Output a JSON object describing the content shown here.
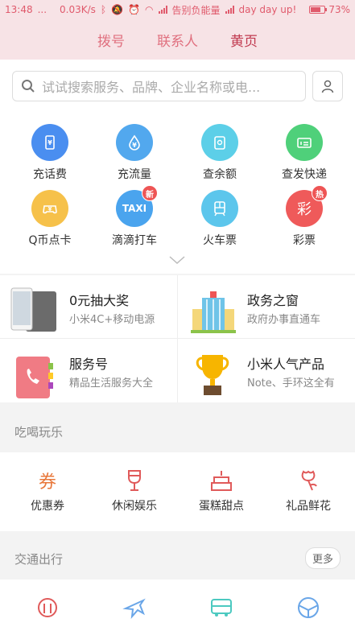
{
  "status": {
    "time": "13:48",
    "dots": "...",
    "speed": "0.03K/s",
    "carrier": "告别负能量",
    "slogan": "day day up!",
    "battery": "73%",
    "battery_level": 0.73
  },
  "tabs": [
    {
      "label": "拨号",
      "active": false
    },
    {
      "label": "联系人",
      "active": false
    },
    {
      "label": "黄页",
      "active": true
    }
  ],
  "search": {
    "placeholder": "试试搜索服务、品牌、企业名称或电..."
  },
  "services": [
    {
      "label": "充话费",
      "color": "#4a8ef0",
      "icon": "phone-yuan-icon",
      "badge": ""
    },
    {
      "label": "充流量",
      "color": "#52a8ee",
      "icon": "drop-yuan-icon",
      "badge": ""
    },
    {
      "label": "查余额",
      "color": "#5ccfe8",
      "icon": "balance-icon",
      "badge": ""
    },
    {
      "label": "查发快递",
      "color": "#4fd07a",
      "icon": "express-icon",
      "badge": ""
    },
    {
      "label": "Q币点卡",
      "color": "#f6c14a",
      "icon": "gamepad-icon",
      "badge": ""
    },
    {
      "label": "滴滴打车",
      "color": "#4aa4ee",
      "icon": "taxi-icon",
      "icon_text": "TAXI",
      "badge": "新"
    },
    {
      "label": "火车票",
      "color": "#5cc6ec",
      "icon": "train-icon",
      "badge": ""
    },
    {
      "label": "彩票",
      "color": "#ef5a5a",
      "icon": "lottery-icon",
      "icon_text": "彩",
      "badge": "热"
    }
  ],
  "promos": [
    {
      "title": "0元抽大奖",
      "subtitle": "小米4C+移动电源",
      "icon": "phone-device-icon"
    },
    {
      "title": "政务之窗",
      "subtitle": "政府办事直通车",
      "icon": "government-building-icon"
    },
    {
      "title": "服务号",
      "subtitle": "精品生活服务大全",
      "icon": "phonebook-icon"
    },
    {
      "title": "小米人气产品",
      "subtitle": "Note、手环这全有",
      "icon": "trophy-icon"
    }
  ],
  "food": {
    "title": "吃喝玩乐",
    "items": [
      {
        "label": "优惠券",
        "icon": "coupon-icon"
      },
      {
        "label": "休闲娱乐",
        "icon": "wine-glass-icon"
      },
      {
        "label": "蛋糕甜点",
        "icon": "cake-icon"
      },
      {
        "label": "礼品鲜花",
        "icon": "flower-icon"
      }
    ]
  },
  "transport": {
    "title": "交通出行",
    "more_label": "更多",
    "items": [
      {
        "icon": "train-ticket-icon"
      },
      {
        "icon": "airplane-icon"
      },
      {
        "icon": "bus-icon"
      },
      {
        "icon": "globe-icon"
      }
    ]
  },
  "colors": {
    "accent": "#c0394f",
    "header_bg": "#f7e3e6",
    "food_icon": "#e8773a",
    "transport_icon": "#e05a5a"
  }
}
